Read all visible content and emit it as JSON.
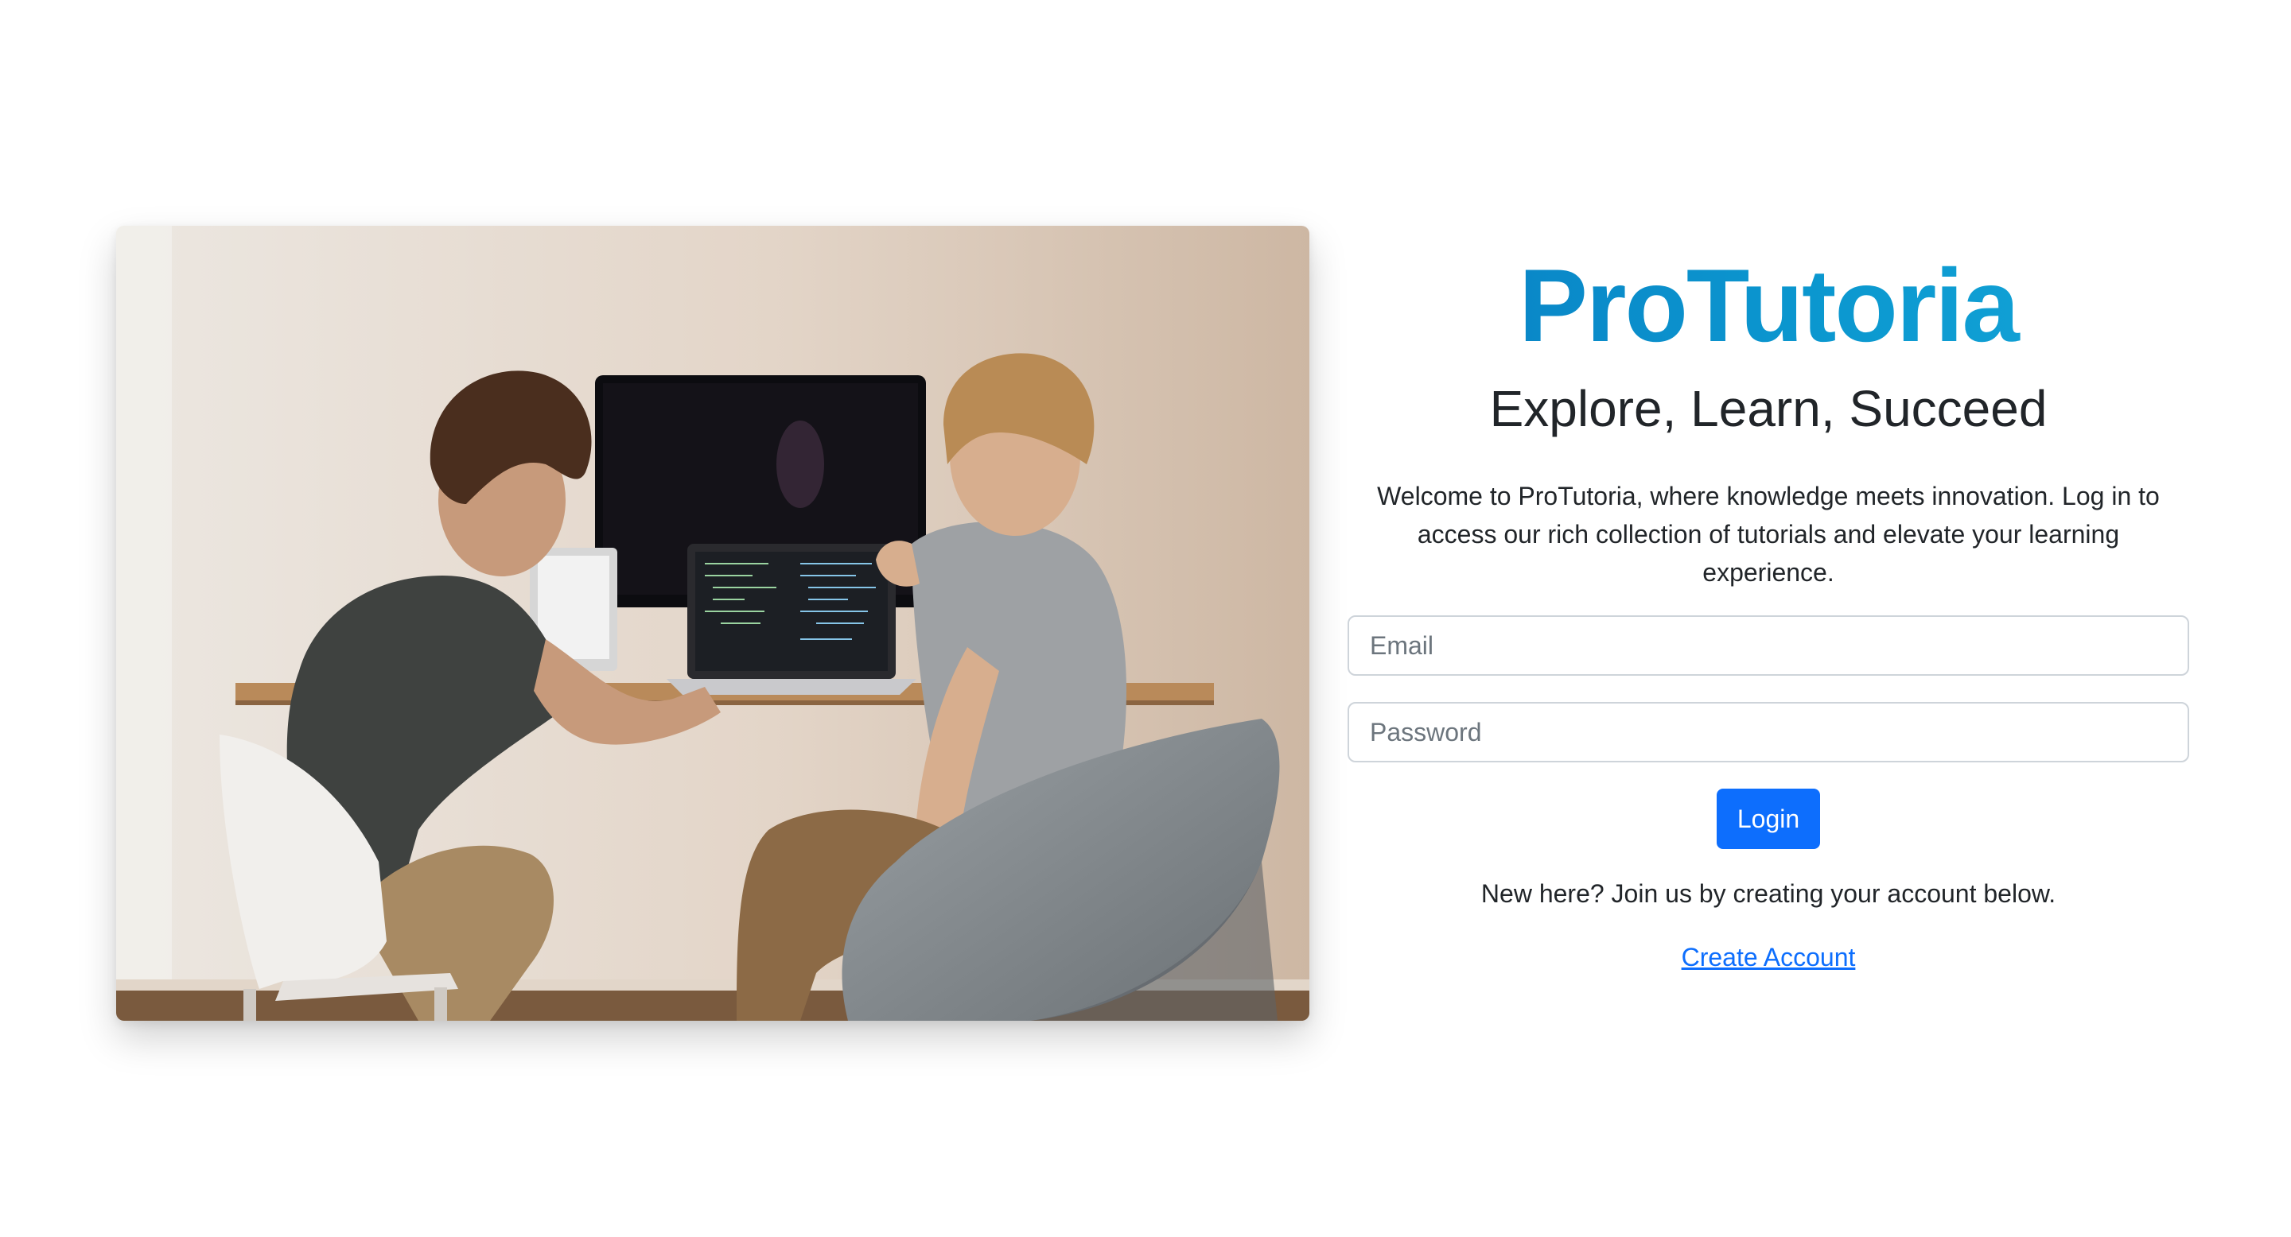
{
  "photo": {
    "icon": "people-coding-photo"
  },
  "brand": {
    "name": "ProTutoria",
    "colors": [
      "#0a7fc4",
      "#14a6d8"
    ]
  },
  "login": {
    "tagline": "Explore, Learn, Succeed",
    "welcome_text": "Welcome to ProTutoria, where knowledge meets innovation. Log in to access our rich collection of tutorials and elevate your learning experience.",
    "email_placeholder": "Email",
    "email_value": "",
    "password_placeholder": "Password",
    "password_value": "",
    "login_label": "Login",
    "login_color": "#0d6efd",
    "signup_prompt": "New here? Join us by creating your account below.",
    "create_account_label": "Create Account",
    "link_color": "#0d6efd"
  }
}
